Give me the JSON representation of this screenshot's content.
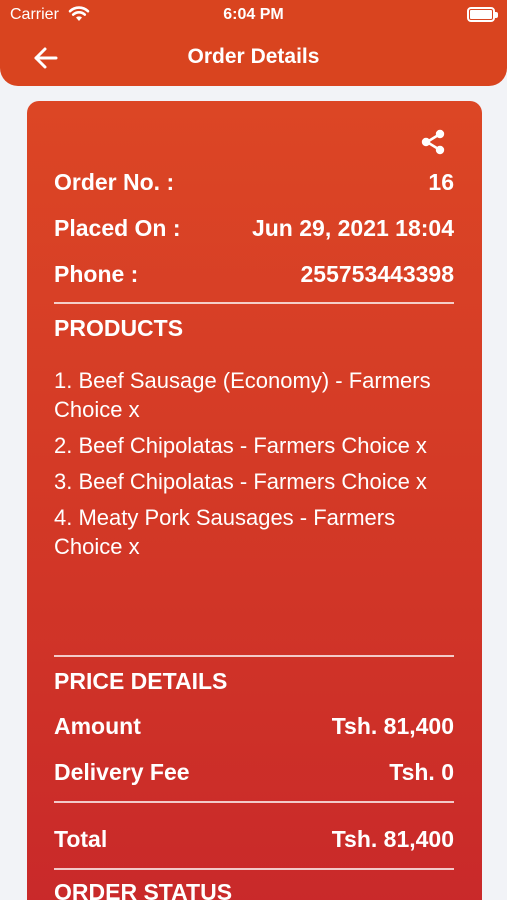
{
  "status_bar": {
    "carrier": "Carrier",
    "time": "6:04 PM"
  },
  "nav": {
    "title": "Order Details"
  },
  "order": {
    "order_no_label": "Order No. :",
    "order_no": "16",
    "placed_on_label": "Placed On :",
    "placed_on": "Jun 29, 2021 18:04",
    "phone_label": "Phone :",
    "phone": "255753443398"
  },
  "products": {
    "title": "PRODUCTS",
    "items": [
      "1. Beef Sausage (Economy) - Farmers Choice x",
      "2. Beef Chipolatas - Farmers Choice x",
      "3. Beef Chipolatas - Farmers Choice x",
      "4. Meaty Pork Sausages - Farmers Choice x"
    ]
  },
  "price": {
    "title": "PRICE DETAILS",
    "amount_label": "Amount",
    "amount": "Tsh. 81,400",
    "delivery_label": "Delivery Fee",
    "delivery": "Tsh. 0",
    "total_label": "Total",
    "total": "Tsh. 81,400"
  },
  "status": {
    "title": "ORDER STATUS"
  },
  "colors": {
    "accent": "#d9441f",
    "card_top": "#dc4625",
    "card_bottom": "#c8282a",
    "background": "#f2f3f7"
  },
  "icons": {
    "back": "arrow-left-icon",
    "share": "share-icon",
    "wifi": "wifi-icon",
    "battery": "battery-icon"
  }
}
